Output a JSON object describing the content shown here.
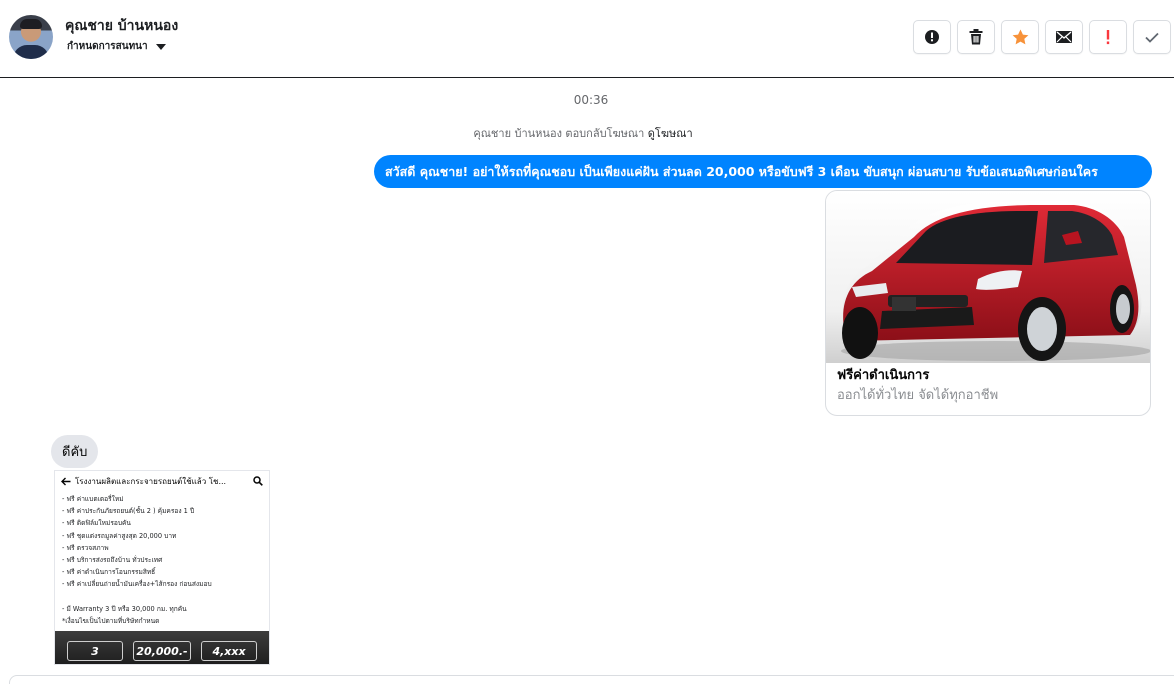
{
  "header": {
    "contact_name": "คุณชาย บ้านหนอง",
    "label_selector": "กำหนดการสนทนา",
    "actions": [
      {
        "name": "alert-circle-icon"
      },
      {
        "name": "trash-icon"
      },
      {
        "name": "star-icon",
        "color": "#f7923a"
      },
      {
        "name": "mail-icon"
      },
      {
        "name": "exclamation-icon",
        "color": "#fa383e"
      },
      {
        "name": "check-icon"
      }
    ]
  },
  "conversation": {
    "time": "00:36",
    "reply_note": {
      "text": "คุณชาย บ้านหนอง ตอบกลับโฆษณา",
      "link": "ดูโฆษณา"
    },
    "outgoing_message": "สวัสดี คุณชาย! อย่าให้รถที่คุณชอบ เป็นเพียงแค่ฝัน ส่วนลด 20,000 หรือขับฟรี 3 เดือน ขับสนุก ผ่อนสบาย รับข้อเสนอพิเศษก่อนใคร",
    "ad_card": {
      "title": "ฟรีค่าดำเนินการ",
      "subtitle": "ออกได้ทั่วไทย จัดได้ทุกอาชีพ"
    },
    "incoming_message": "ดีคับ",
    "screenshot": {
      "bar_title": "โรงงานผลิตและกระจายรถยนต์ใช้แล้ว โช...",
      "lines": [
        "- ฟรี ค่าแบตเตอรี่ใหม่",
        "- ฟรี ค่าประกันภัยรถยนต์(ชั้น 2 ) คุ้มครอง 1 ปี",
        "- ฟรี ติดฟิล์มใหม่รอบคัน",
        "- ฟรี ชุดแต่งรถมูลค่าสูงสุด 20,000 บาท",
        "- ฟรี ตรวจสภาพ",
        "- ฟรี บริการส่งรถถึงบ้าน ทั่วประเทศ",
        "- ฟรี ค่าดำเนินการโอนกรรมสิทธิ์",
        "- ฟรี ค่าเปลี่ยนถ่ายน้ำมันเครื่อง+ไส้กรอง ก่อนส่งมอบ",
        "",
        "- มี Warranty 3 ปี หรือ 30,000 กม. ทุกคัน",
        "*เงื่อนไขเป็นไปตามที่บริษัทกำหนด"
      ],
      "promo": {
        "box1": "3",
        "box2": "20,000.-",
        "box3": "4,xxx"
      }
    }
  },
  "colors": {
    "accent": "#0084ff",
    "incoming_bubble": "#e4e6eb"
  }
}
